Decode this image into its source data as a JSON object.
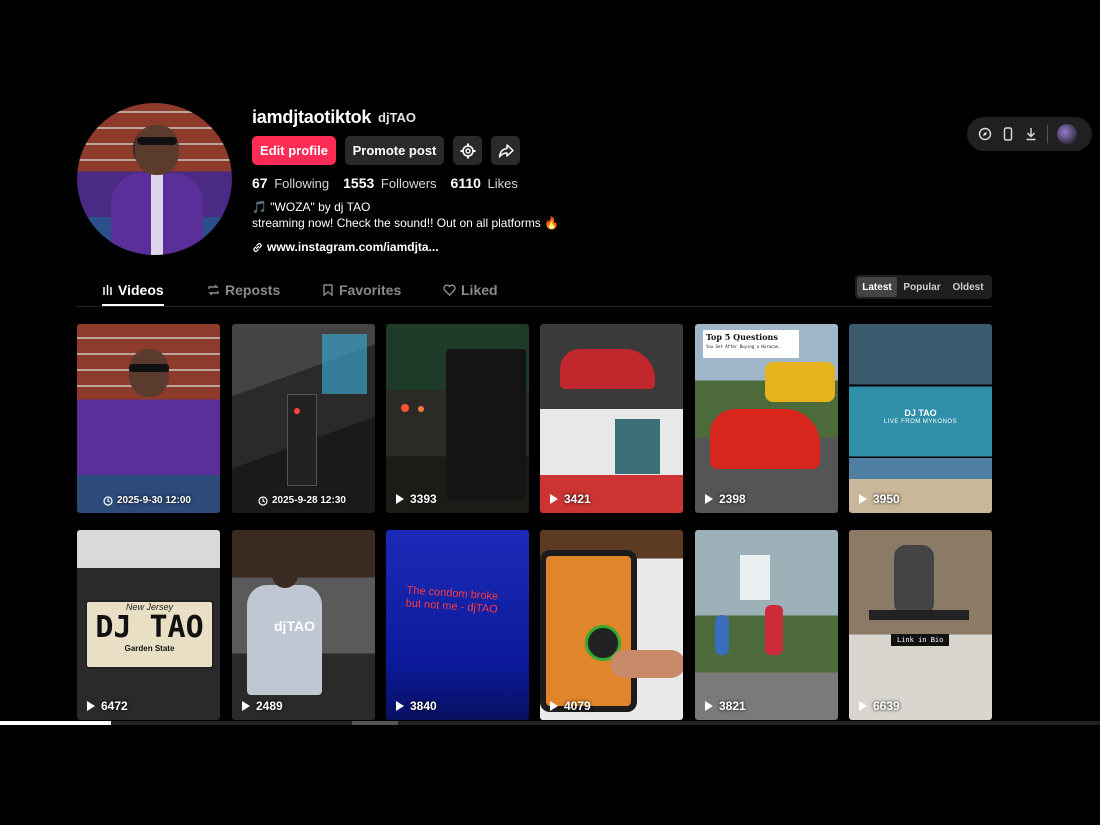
{
  "profile": {
    "username": "iamdjtaotiktok",
    "nickname": "djTAO",
    "edit_label": "Edit profile",
    "promote_label": "Promote post",
    "following_count": "67",
    "following_label": "Following",
    "followers_count": "1553",
    "followers_label": "Followers",
    "likes_count": "6110",
    "likes_label": "Likes",
    "bio_line1": "🎵 \"WOZA\" by dj TAO",
    "bio_line2": "streaming now! Check the sound!! Out on all platforms 🔥",
    "link": "www.instagram.com/iamdjta..."
  },
  "tabs": [
    {
      "label": "Videos",
      "icon": "bars-icon",
      "active": true
    },
    {
      "label": "Reposts",
      "icon": "repost-icon"
    },
    {
      "label": "Favorites",
      "icon": "bookmark-icon"
    },
    {
      "label": "Liked",
      "icon": "heart-icon"
    }
  ],
  "sort": {
    "latest": "Latest",
    "popular": "Popular",
    "oldest": "Oldest",
    "selected": "Latest"
  },
  "videos": [
    {
      "meta": "2025-9-30 12:00",
      "kind": "scheduled"
    },
    {
      "meta": "2025-9-28 12:30",
      "kind": "scheduled"
    },
    {
      "meta": "3393",
      "kind": "views"
    },
    {
      "meta": "3421",
      "kind": "views"
    },
    {
      "meta": "2398",
      "kind": "views",
      "overlay_title": "Top 5 Questions",
      "overlay_sub": "You Get After Buying a Huracan."
    },
    {
      "meta": "3950",
      "kind": "views",
      "overlay_title": "DJ TAO",
      "overlay_sub": "LIVE FROM MYKONOS"
    },
    {
      "meta": "6472",
      "kind": "views",
      "overlay_title": "DJ TAO",
      "overlay_top": "New Jersey",
      "overlay_sub": "Garden State"
    },
    {
      "meta": "2489",
      "kind": "views",
      "overlay_title": "djTAO"
    },
    {
      "meta": "3840",
      "kind": "views",
      "overlay_title": "The condom broke but not me - djTAO"
    },
    {
      "meta": "4079",
      "kind": "views"
    },
    {
      "meta": "3821",
      "kind": "views"
    },
    {
      "meta": "6639",
      "kind": "views",
      "overlay_title": "Link in Bio"
    }
  ],
  "colors": {
    "accent": "#fe2c55",
    "background": "#000000",
    "button_dark": "#2a2a2a"
  }
}
